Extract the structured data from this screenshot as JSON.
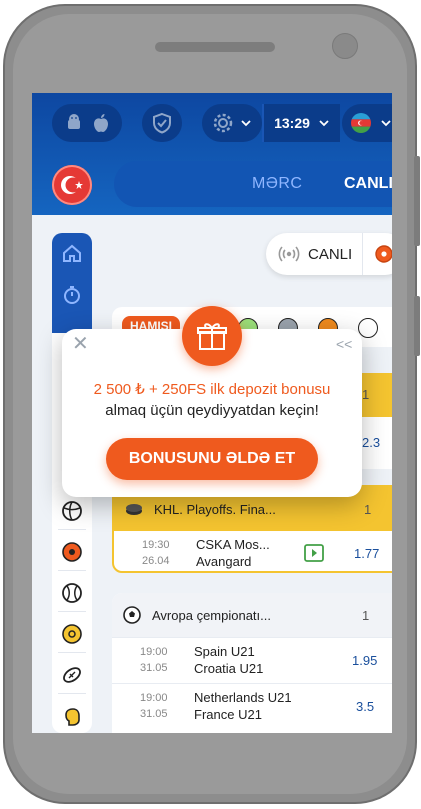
{
  "header": {
    "time": "13:29",
    "nav": {
      "bet_label": "MƏRC",
      "live_label": "CANLI"
    },
    "icons": [
      "android-icon",
      "apple-icon",
      "shield-icon",
      "gear-icon",
      "chevron-down-icon",
      "azerbaijan-flag-icon"
    ]
  },
  "live_filter": {
    "label": "CANLI"
  },
  "filters": {
    "all_label": "HAMISI"
  },
  "popup": {
    "line1": "2 500 ₺ + 250FS ilk depozit bonusu",
    "line2": "almaq üçün qeydiyyatdan keçin!",
    "cta_label": "BONUSUNU ƏLDƏ ET",
    "collapse_label": "<<"
  },
  "hidden_partial": {
    "count": "1",
    "odd": "2.3"
  },
  "leagues": [
    {
      "title": "KHL. Playoffs. Fina...",
      "count": "1",
      "matches": [
        {
          "time": "19:30",
          "date": "26.04",
          "home": "CSKA Mos...",
          "away": "Avangard",
          "odd": "1.77"
        }
      ]
    },
    {
      "title": "Avropa çempionatı...",
      "count": "1",
      "matches": [
        {
          "time": "19:00",
          "date": "31.05",
          "home": "Spain U21",
          "away": "Croatia U21",
          "odd": "1.95"
        },
        {
          "time": "19:00",
          "date": "31.05",
          "home": "Netherlands U21",
          "away": "France U21",
          "odd": "3.5"
        }
      ]
    }
  ],
  "colors": {
    "brand_blue": "#0d47a1",
    "accent_orange": "#ef5a1e",
    "odd_blue": "#1a4f9c",
    "highlight_yellow": "#f4c430"
  }
}
